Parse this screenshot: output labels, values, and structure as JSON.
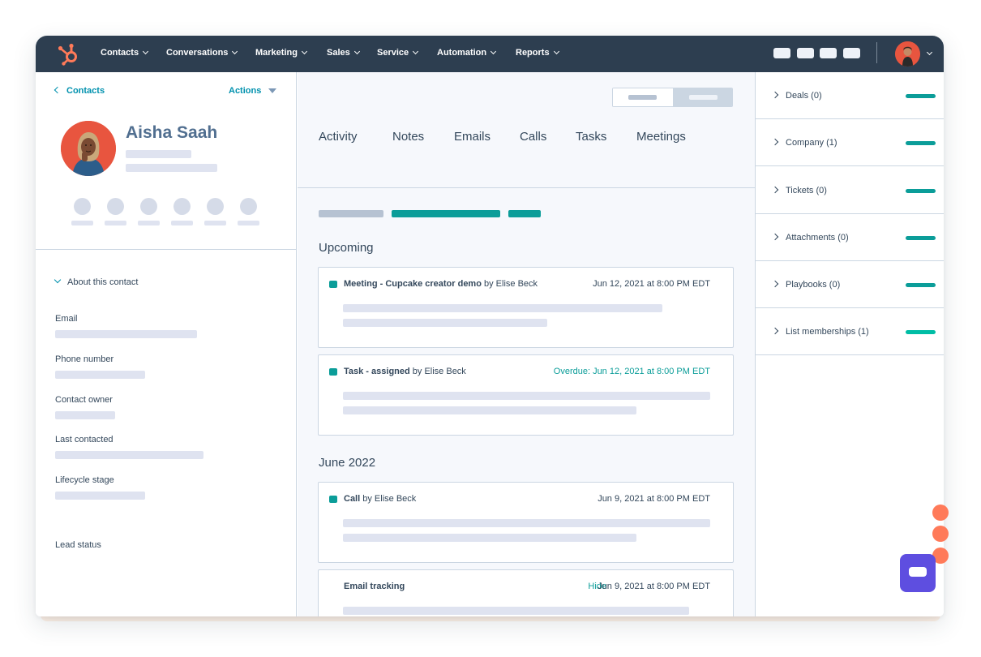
{
  "nav": {
    "items": [
      "Contacts",
      "Conversations",
      "Marketing",
      "Sales",
      "Service",
      "Automation",
      "Reports"
    ]
  },
  "contact": {
    "back_label": "Contacts",
    "actions_label": "Actions",
    "name": "Aisha Saah",
    "about_label": "About this contact",
    "fields": [
      "Email",
      "Phone number",
      "Contact owner",
      "Last contacted",
      "Lifecycle stage",
      "Lead status"
    ]
  },
  "tabs": [
    "Activity",
    "Notes",
    "Emails",
    "Calls",
    "Tasks",
    "Meetings"
  ],
  "timeline": {
    "upcoming_heading": "Upcoming",
    "month_heading": "June 2022",
    "cards": [
      {
        "type": "Meeting - Cupcake creator demo",
        "by": "by Elise Beck",
        "date": "Jun 12, 2021 at 8:00 PM EDT"
      },
      {
        "type": "Task - assigned",
        "by": "by Elise Beck",
        "date": "Overdue: Jun 12, 2021 at 8:00 PM EDT"
      },
      {
        "type": "Call",
        "by": "by Elise Beck",
        "date": "Jun 9, 2021 at 8:00 PM EDT"
      },
      {
        "type": "Email tracking",
        "by": "",
        "hide": "Hide",
        "date": "Jun 9, 2021 at 8:00 PM EDT"
      }
    ]
  },
  "sidebar": {
    "items": [
      "Deals (0)",
      "Company (1)",
      "Tickets (0)",
      "Attachments (0)",
      "Playbooks (0)",
      "List memberships (1)"
    ]
  },
  "colors": {
    "nav_bg": "#2d3e50",
    "teal": "#0b9d99",
    "link": "#0091ae",
    "brand_orange": "#ff7a59",
    "chat_purple": "#5e4ee0"
  },
  "icons": [
    "hubspot-logo-icon",
    "chevron-down-icon",
    "chevron-left-icon",
    "chevron-right-icon",
    "chat-icon"
  ]
}
